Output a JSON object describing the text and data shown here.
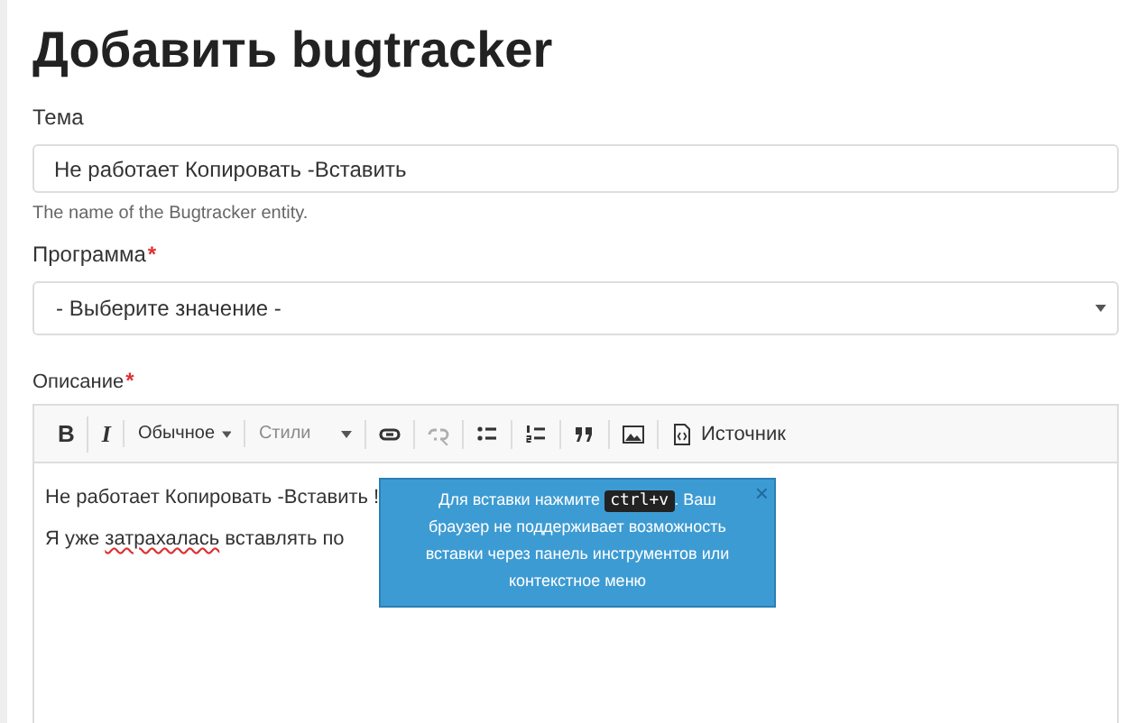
{
  "title": "Добавить bugtracker",
  "required_mark": "*",
  "fields": [
    {
      "kind": "text",
      "label": "Тема",
      "required": false,
      "value": "Не работает Копировать -Вставить",
      "help": "The name of the Bugtracker entity."
    },
    {
      "kind": "select",
      "label": "Программа",
      "required": true,
      "value": "- Выберите значение -"
    }
  ],
  "description": {
    "label": "Описание",
    "required": true,
    "toolbar": [
      [
        {
          "kind": "bold",
          "label": "B",
          "disabled": false
        }
      ],
      [
        {
          "kind": "italic",
          "label": "I",
          "disabled": false
        }
      ],
      [
        {
          "kind": "dropdown",
          "label": "Обычное",
          "disabled": false
        }
      ],
      [
        {
          "kind": "dropdown",
          "label": "Стили",
          "disabled": true
        }
      ],
      [
        {
          "kind": "link",
          "disabled": false
        }
      ],
      [
        {
          "kind": "unlink",
          "disabled": true
        }
      ],
      [
        {
          "kind": "bullets",
          "disabled": false
        }
      ],
      [
        {
          "kind": "numbers",
          "disabled": false
        }
      ],
      [
        {
          "kind": "quote",
          "disabled": false
        }
      ],
      [
        {
          "kind": "image",
          "disabled": false
        }
      ],
      [
        {
          "kind": "source",
          "label": "Источник",
          "disabled": false
        }
      ]
    ],
    "content": [
      [
        {
          "text": "Не работает Копировать -Вставить !",
          "misspelled": false
        }
      ],
      [
        {
          "text": "Я уже ",
          "misspelled": false
        },
        {
          "text": "затрахалась",
          "misspelled": true
        },
        {
          "text": " вставлять по",
          "misspelled": false
        }
      ]
    ],
    "tooltip": {
      "before": "Для вставки нажмите",
      "key": "ctrl+v",
      "after": ". Ваш браузер не поддерживает возможность вставки через панель инструментов или контекстное меню",
      "close": "×"
    }
  }
}
